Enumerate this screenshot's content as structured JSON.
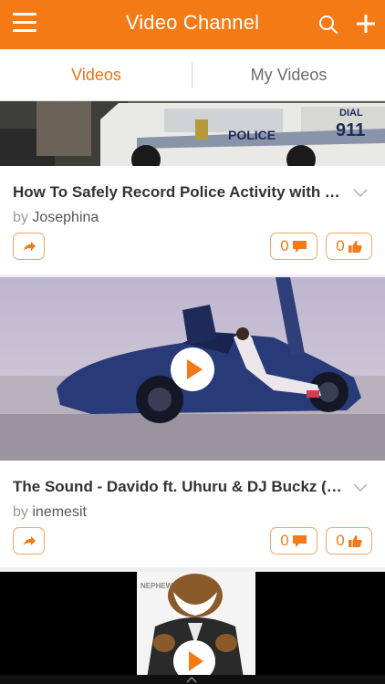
{
  "appbar": {
    "title": "Video Channel",
    "menu_icon": "hamburger-menu-icon",
    "search_icon": "search-icon",
    "add_icon": "plus-icon"
  },
  "tabs": [
    {
      "label": "Videos",
      "active": true
    },
    {
      "label": "My Videos",
      "active": false
    }
  ],
  "videos": [
    {
      "title": "How To Safely Record Police Activity with Yo...",
      "by": "by",
      "author": "Josephina",
      "comments": "0",
      "likes": "0",
      "thumb_text_police": "POLICE",
      "thumb_text_dial": "DIAL",
      "thumb_text_911": "911"
    },
    {
      "title": "The Sound - Davido ft. Uhuru & DJ Buckz (Of...",
      "by": "by",
      "author": "inemesit",
      "comments": "0",
      "likes": "0"
    },
    {
      "thumb_text": "NEPHEW"
    }
  ],
  "colors": {
    "accent": "#f47a16",
    "accent_border": "#f0a566",
    "title_text": "#333333",
    "muted_text": "#9a9a9a"
  }
}
